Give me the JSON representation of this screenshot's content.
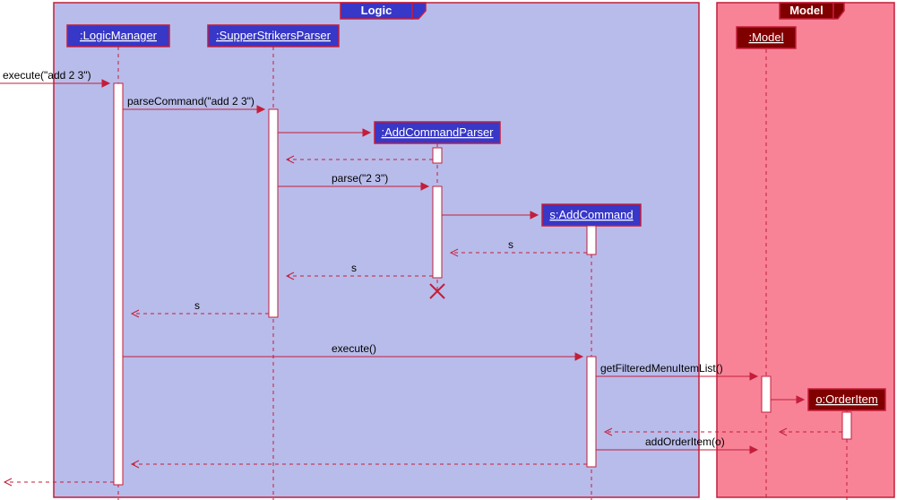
{
  "frames": {
    "logic": "Logic",
    "model": "Model"
  },
  "participants": {
    "logicManager": ":LogicManager",
    "parser": ":SupperStrikersParser",
    "addParser": ":AddCommandParser",
    "addCmd": "s:AddCommand",
    "model": ":Model",
    "orderItem": "o:OrderItem"
  },
  "messages": {
    "m1": "execute(\"add 2 3\")",
    "m2": "parseCommand(\"add 2 3\")",
    "m3": "parse(\"2 3\")",
    "r1": "s",
    "r2": "s",
    "r3": "s",
    "m4": "execute()",
    "m5": "getFilteredMenuItemList()",
    "m6": "addOrderItem(o)"
  }
}
